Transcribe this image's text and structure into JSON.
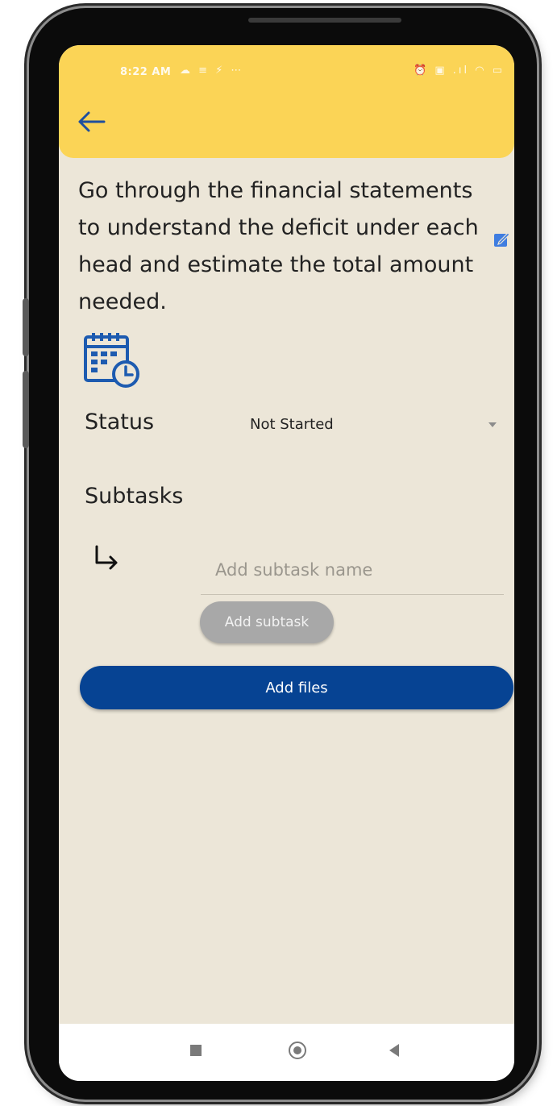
{
  "status_bar": {
    "time": "8:22 AM",
    "left_icons": "☁ ≡ ⚡ ⋯",
    "right_icons": "⏰ ▣ .ıl ◠ ▭"
  },
  "task": {
    "description": "Go through the financial statements to understand the deficit under each head and estimate the total amount needed."
  },
  "status": {
    "label": "Status",
    "value": "Not Started"
  },
  "subtasks": {
    "label": "Subtasks",
    "input_placeholder": "Add subtask name",
    "add_button_label": "Add subtask"
  },
  "files": {
    "add_button_label": "Add files"
  },
  "colors": {
    "appbar": "#fbd456",
    "background": "#ece6d8",
    "primary": "#064393",
    "back_arrow": "#1f4f9e",
    "edit_icon": "#3f7de0",
    "calendar_icon": "#1d5bb0",
    "disabled_button": "#a8a8a8"
  },
  "icons": {
    "back": "back-arrow-icon",
    "edit": "edit-icon",
    "calendar": "calendar-clock-icon",
    "subtask": "subdirectory-arrow-icon",
    "dropdown": "dropdown-arrow-icon",
    "nav_recents": "recents-square-icon",
    "nav_home": "home-circle-icon",
    "nav_back": "back-triangle-icon"
  }
}
